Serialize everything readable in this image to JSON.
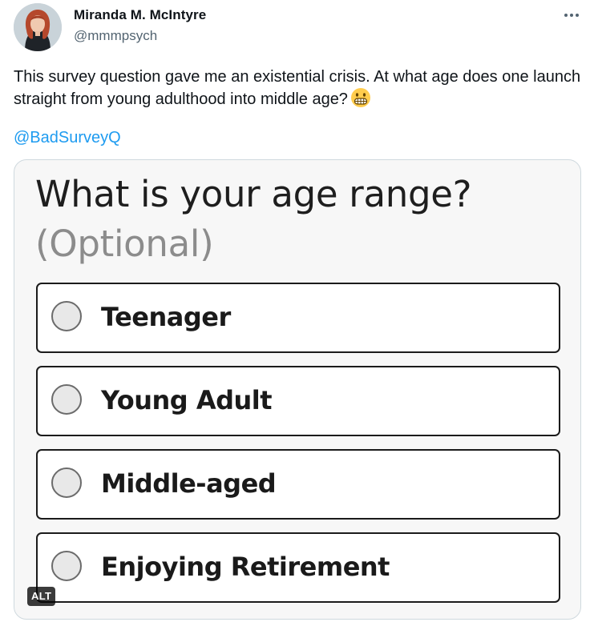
{
  "author": {
    "name": "Miranda M. McIntyre",
    "handle": "@mmmpsych",
    "avatar_icon": "profile-photo"
  },
  "more_icon": "ellipsis-icon",
  "tweet": {
    "text": "This survey question gave me an existential crisis. At what age does one launch straight from young adulthood into middle age?",
    "emoji": "grimacing-face",
    "mention": "@BadSurveyQ"
  },
  "survey": {
    "title": "What is your age range?",
    "subtitle": "(Optional)",
    "options": [
      {
        "label": "Teenager"
      },
      {
        "label": "Young Adult"
      },
      {
        "label": "Middle-aged"
      },
      {
        "label": "Enjoying Retirement"
      }
    ]
  },
  "media": {
    "alt_badge": "ALT"
  },
  "colors": {
    "link": "#1d9bf0",
    "handle": "#536471",
    "text": "#0f1419"
  }
}
